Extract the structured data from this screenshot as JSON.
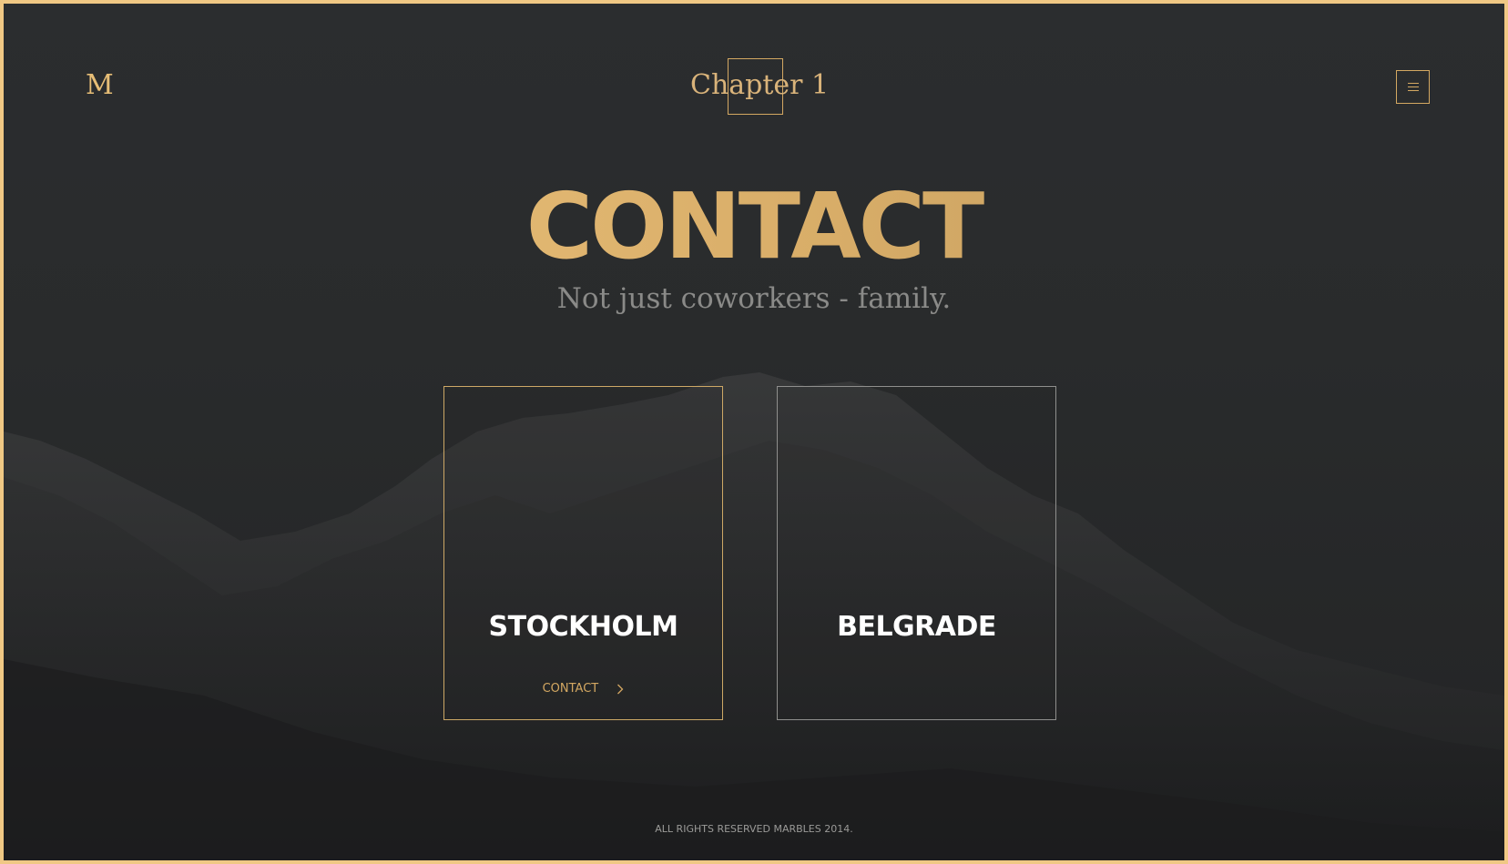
{
  "header": {
    "logo": "M",
    "chapter_title": "Chapter 1",
    "menu_icon": "hamburger-menu-icon"
  },
  "hero": {
    "title": "CONTACT",
    "subtitle": "Not just coworkers - family."
  },
  "offices": [
    {
      "city": "STOCKHOLM",
      "link_label": "CONTACT",
      "link_icon": "chevron-right-icon"
    },
    {
      "city": "BELGRADE"
    }
  ],
  "footer": {
    "copyright": "ALL RIGHTS RESERVED MARBLES 2014."
  },
  "colors": {
    "frame": "#f0c884",
    "accent": "#d4a862",
    "background": "#2a2b2d",
    "text_light": "#ffffff",
    "text_muted": "#8a8a88"
  }
}
